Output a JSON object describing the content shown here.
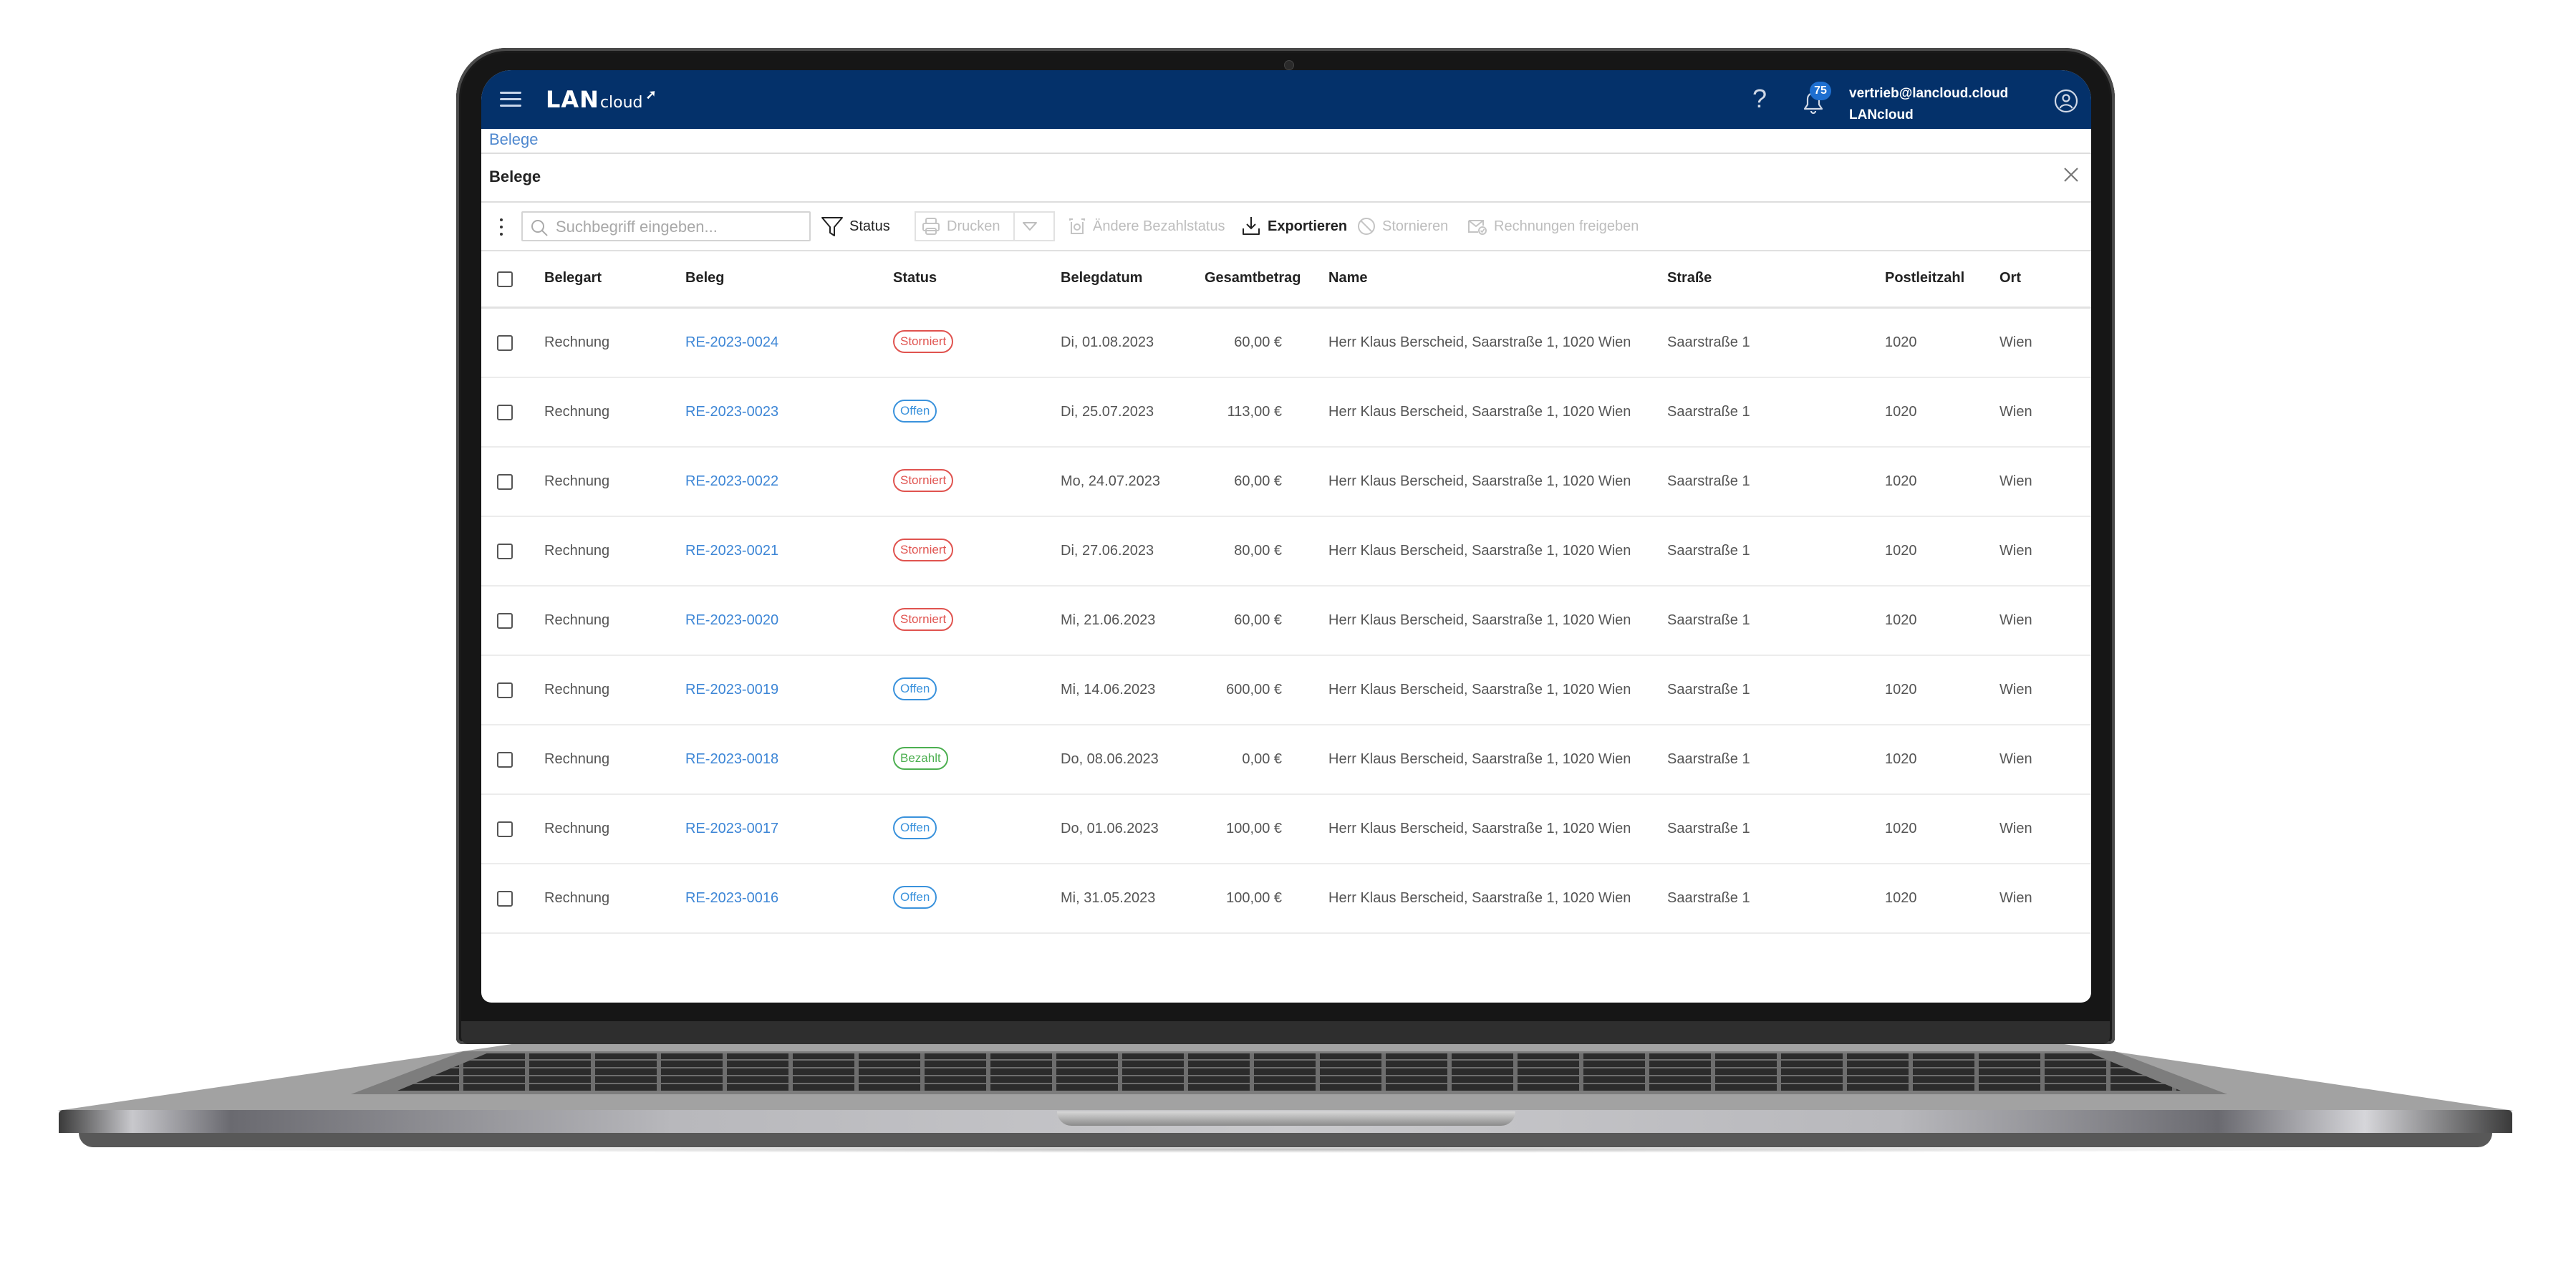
{
  "app": {
    "logo_main": "LAN",
    "logo_sub": "cloud",
    "logo_arrow": "➚",
    "help_icon": "?",
    "notifications_count": "75",
    "user_email": "vertrieb@lancloud.cloud",
    "user_org": "LANcloud",
    "colors": {
      "header_bg": "#04316a",
      "link": "#3d86d6",
      "badge": "#1e6fd0",
      "status_storniert": "#e0534f",
      "status_offen": "#3a92dc",
      "status_bezahlt": "#4caf50"
    }
  },
  "breadcrumb": "Belege",
  "page_title": "Belege",
  "toolbar": {
    "search_placeholder": "Suchbegriff eingeben...",
    "search_value": "",
    "status_filter": "Status",
    "print": "Drucken",
    "change_payment_status": "Ändere Bezahlstatus",
    "export": "Exportieren",
    "cancel": "Stornieren",
    "release_invoices": "Rechnungen freigeben"
  },
  "table": {
    "columns": [
      "Belegart",
      "Beleg",
      "Status",
      "Belegdatum",
      "Gesamtbetrag",
      "Name",
      "Straße",
      "Postleitzahl",
      "Ort"
    ],
    "rows": [
      {
        "type": "Rechnung",
        "number": "RE-2023-0024",
        "status": "Storniert",
        "status_kind": "storniert",
        "date": "Di, 01.08.2023",
        "amount": "60,00 €",
        "name": "Herr Klaus Berscheid, Saarstraße 1, 1020 Wien",
        "street": "Saarstraße 1",
        "zip": "1020",
        "city": "Wien"
      },
      {
        "type": "Rechnung",
        "number": "RE-2023-0023",
        "status": "Offen",
        "status_kind": "offen",
        "date": "Di, 25.07.2023",
        "amount": "113,00 €",
        "name": "Herr Klaus Berscheid, Saarstraße 1, 1020 Wien",
        "street": "Saarstraße 1",
        "zip": "1020",
        "city": "Wien"
      },
      {
        "type": "Rechnung",
        "number": "RE-2023-0022",
        "status": "Storniert",
        "status_kind": "storniert",
        "date": "Mo, 24.07.2023",
        "amount": "60,00 €",
        "name": "Herr Klaus Berscheid, Saarstraße 1, 1020 Wien",
        "street": "Saarstraße 1",
        "zip": "1020",
        "city": "Wien"
      },
      {
        "type": "Rechnung",
        "number": "RE-2023-0021",
        "status": "Storniert",
        "status_kind": "storniert",
        "date": "Di, 27.06.2023",
        "amount": "80,00 €",
        "name": "Herr Klaus Berscheid, Saarstraße 1, 1020 Wien",
        "street": "Saarstraße 1",
        "zip": "1020",
        "city": "Wien"
      },
      {
        "type": "Rechnung",
        "number": "RE-2023-0020",
        "status": "Storniert",
        "status_kind": "storniert",
        "date": "Mi, 21.06.2023",
        "amount": "60,00 €",
        "name": "Herr Klaus Berscheid, Saarstraße 1, 1020 Wien",
        "street": "Saarstraße 1",
        "zip": "1020",
        "city": "Wien"
      },
      {
        "type": "Rechnung",
        "number": "RE-2023-0019",
        "status": "Offen",
        "status_kind": "offen",
        "date": "Mi, 14.06.2023",
        "amount": "600,00 €",
        "name": "Herr Klaus Berscheid, Saarstraße 1, 1020 Wien",
        "street": "Saarstraße 1",
        "zip": "1020",
        "city": "Wien"
      },
      {
        "type": "Rechnung",
        "number": "RE-2023-0018",
        "status": "Bezahlt",
        "status_kind": "bezahlt",
        "date": "Do, 08.06.2023",
        "amount": "0,00 €",
        "name": "Herr Klaus Berscheid, Saarstraße 1, 1020 Wien",
        "street": "Saarstraße 1",
        "zip": "1020",
        "city": "Wien"
      },
      {
        "type": "Rechnung",
        "number": "RE-2023-0017",
        "status": "Offen",
        "status_kind": "offen",
        "date": "Do, 01.06.2023",
        "amount": "100,00 €",
        "name": "Herr Klaus Berscheid, Saarstraße 1, 1020 Wien",
        "street": "Saarstraße 1",
        "zip": "1020",
        "city": "Wien"
      },
      {
        "type": "Rechnung",
        "number": "RE-2023-0016",
        "status": "Offen",
        "status_kind": "offen",
        "date": "Mi, 31.05.2023",
        "amount": "100,00 €",
        "name": "Herr Klaus Berscheid, Saarstraße 1, 1020 Wien",
        "street": "Saarstraße 1",
        "zip": "1020",
        "city": "Wien"
      }
    ]
  }
}
